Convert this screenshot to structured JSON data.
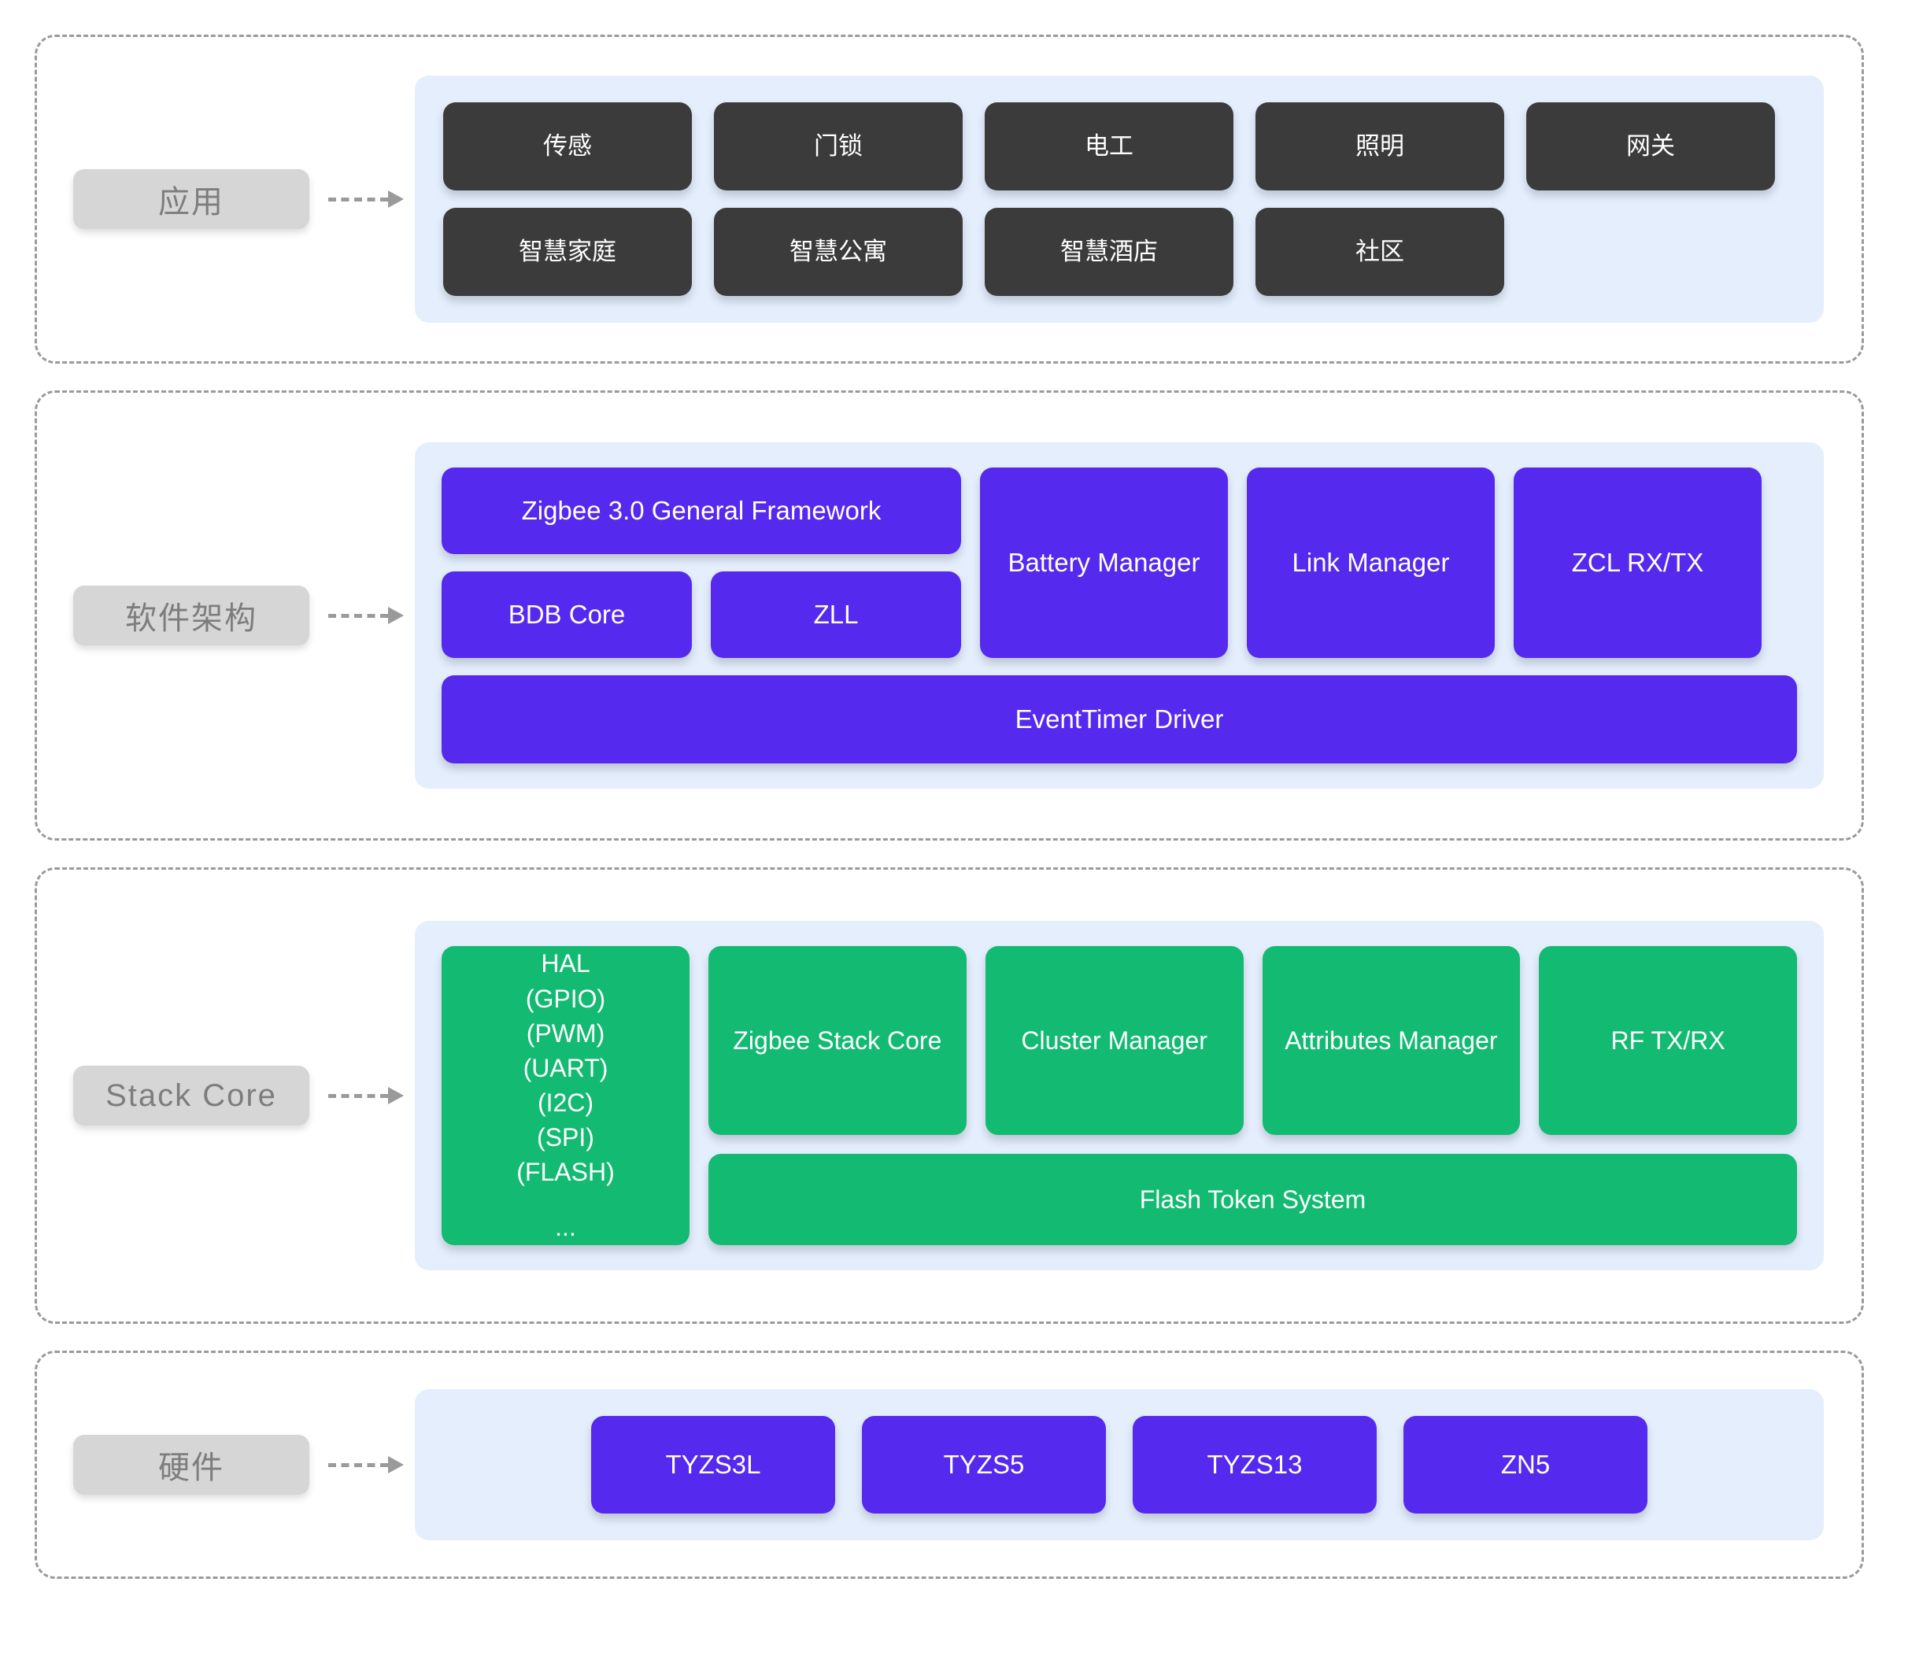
{
  "colors": {
    "dark": "#3b3b3b",
    "purple": "#5629ee",
    "green": "#13ba72",
    "panel_bg": "#e4eefd",
    "label_pill": "#d6d6d6",
    "label_text": "#7d7d7d",
    "frame_border": "#9a9a9a"
  },
  "layers": [
    {
      "label": "应用",
      "rows": [
        [
          "传感",
          "门锁",
          "电工",
          "照明",
          "网关"
        ],
        [
          "智慧家庭",
          "智慧公寓",
          "智慧酒店",
          "社区"
        ]
      ]
    },
    {
      "label": "软件架构",
      "framework": "Zigbee 3.0 General Framework",
      "bdb_core": "BDB Core",
      "zll": "ZLL",
      "battery_manager": "Battery Manager",
      "link_manager": "Link Manager",
      "zcl_rx_tx": "ZCL RX/TX",
      "event_timer": "EventTimer Driver"
    },
    {
      "label": "Stack Core",
      "hal_lines": [
        "HAL",
        "(GPIO)",
        "(PWM)",
        "(UART)",
        "(I2C)",
        "(SPI)",
        "(FLASH)"
      ],
      "hal_ellipsis": "...",
      "zigbee_stack_core": "Zigbee Stack Core",
      "cluster_manager": "Cluster Manager",
      "attributes_manager": "Attributes Manager",
      "rf_tx_rx": "RF TX/RX",
      "flash_token_system": "Flash Token System"
    },
    {
      "label": "硬件",
      "chips": [
        "TYZS3L",
        "TYZS5",
        "TYZS13",
        "ZN5"
      ]
    }
  ]
}
